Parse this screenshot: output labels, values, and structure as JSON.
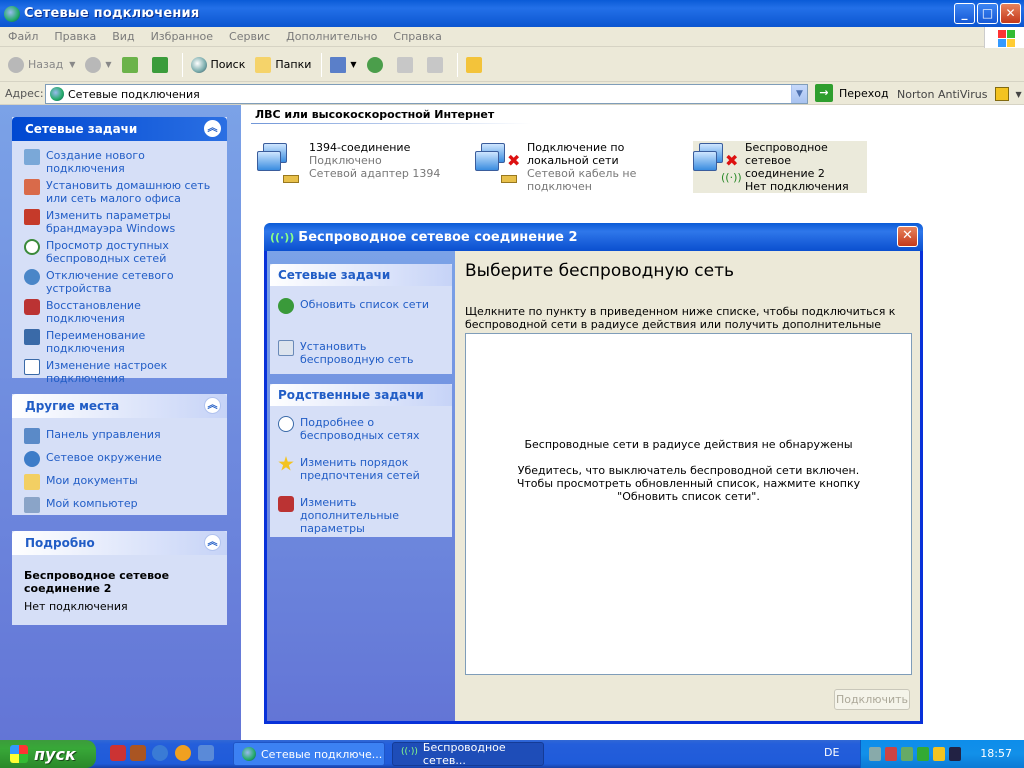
{
  "window": {
    "title": "Сетевые подключения",
    "buttons": {
      "minimize": "_",
      "maximize": "□",
      "close": "✕"
    }
  },
  "menu": [
    "Файл",
    "Правка",
    "Вид",
    "Избранное",
    "Сервис",
    "Дополнительно",
    "Справка"
  ],
  "toolbar": {
    "back": "Назад",
    "search": "Поиск",
    "folders": "Папки"
  },
  "address": {
    "label": "Адрес:",
    "value": "Сетевые подключения",
    "go": "Переход",
    "norton": "Norton AntiVirus"
  },
  "left_panels": {
    "network_tasks": {
      "title": "Сетевые задачи",
      "items": [
        "Создание нового подключения",
        "Установить домашнюю сеть или сеть малого офиса",
        "Изменить параметры брандмауэра Windows",
        "Просмотр доступных беспроводных сетей",
        "Отключение сетевого устройства",
        "Восстановление подключения",
        "Переименование подключения",
        "Изменение настроек подключения"
      ]
    },
    "other_places": {
      "title": "Другие места",
      "items": [
        "Панель управления",
        "Сетевое окружение",
        "Мои документы",
        "Мой компьютер"
      ]
    },
    "details": {
      "title": "Подробно",
      "name": "Беспроводное сетевое соединение 2",
      "status": "Нет подключения"
    }
  },
  "content": {
    "group_header": "ЛВС или высокоскоростной Интернет",
    "connections": [
      {
        "name": "1394-соединение",
        "status": "Подключено",
        "device": "Сетевой адаптер 1394"
      },
      {
        "name": "Подключение по локальной сети",
        "device": "Сетевой кабель не подключен"
      },
      {
        "name": "Беспроводное сетевое соединение 2",
        "status": "Нет подключения"
      }
    ]
  },
  "dialog": {
    "title": "Беспроводное сетевое соединение 2",
    "tasks_title": "Сетевые задачи",
    "tasks": [
      "Обновить список сети",
      "Установить беспроводную сеть"
    ],
    "related_title": "Родственные задачи",
    "related": [
      "Подробнее о беспроводных сетях",
      "Изменить порядок предпочтения  сетей",
      "Изменить дополнительные параметры"
    ],
    "heading": "Выберите беспроводную сеть",
    "description": "Щелкните по пункту в приведенном ниже списке, чтобы подключиться к беспроводной сети в радиусе действия или получить дополнительные сведения.",
    "empty_line1": "Беспроводные сети в радиусе действия не обнаружены",
    "empty_line2": "Убедитесь, что выключатель беспроводной сети включен.",
    "empty_line3": "Чтобы просмотреть обновленный список, нажмите кнопку \"Обновить список сети\".",
    "connect_button": "Подключить"
  },
  "taskbar": {
    "start": "пуск",
    "tasks": [
      "Сетевые подключе...",
      "Беспроводное сетев..."
    ],
    "language": "DE",
    "clock": "18:57"
  }
}
